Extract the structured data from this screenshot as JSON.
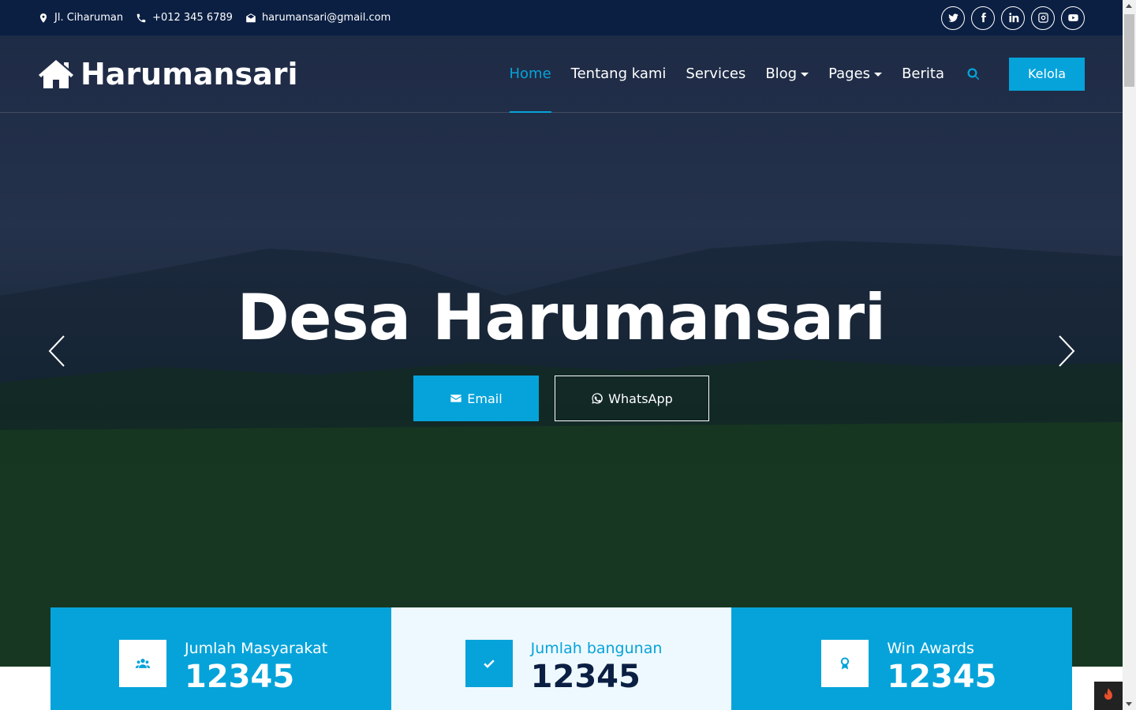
{
  "topbar": {
    "address": "Jl. Ciharuman",
    "phone": "+012 345 6789",
    "email": "harumansari@gmail.com",
    "social_icons": [
      "twitter-icon",
      "facebook-icon",
      "linkedin-icon",
      "instagram-icon",
      "youtube-icon"
    ]
  },
  "brand": {
    "name": "Harumansari",
    "icon": "home-icon"
  },
  "nav": {
    "items": [
      {
        "label": "Home",
        "active": true
      },
      {
        "label": "Tentang kami"
      },
      {
        "label": "Services"
      },
      {
        "label": "Blog",
        "dropdown": true
      },
      {
        "label": "Pages",
        "dropdown": true
      },
      {
        "label": "Berita"
      }
    ],
    "cta": "Kelola"
  },
  "hero": {
    "title": "Desa Harumansari",
    "email_btn": "Email",
    "whatsapp_btn": "WhatsApp"
  },
  "stats": [
    {
      "label": "Jumlah Masyarakat",
      "value": "12345",
      "icon": "users-icon"
    },
    {
      "label": "Jumlah bangunan",
      "value": "12345",
      "icon": "check-icon"
    },
    {
      "label": "Win Awards",
      "value": "12345",
      "icon": "award-icon"
    }
  ],
  "colors": {
    "primary": "#06a3da",
    "dark": "#0b1f43",
    "light": "#eef9ff"
  }
}
